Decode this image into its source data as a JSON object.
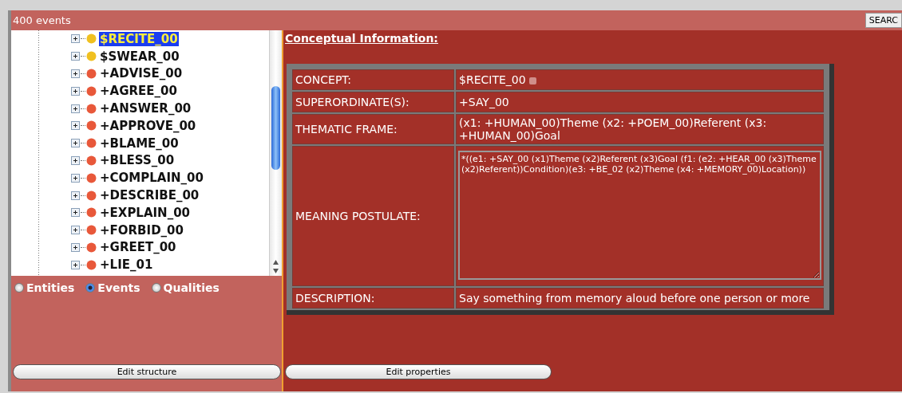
{
  "header": {
    "count": "400 events",
    "search_button": "SEARC"
  },
  "tree": [
    {
      "label": "$RECITE_00",
      "color": "#f0c020",
      "selected": true
    },
    {
      "label": "$SWEAR_00",
      "color": "#f0c020",
      "selected": false
    },
    {
      "label": "+ADVISE_00",
      "color": "#e8583a",
      "selected": false
    },
    {
      "label": "+AGREE_00",
      "color": "#e8583a",
      "selected": false
    },
    {
      "label": "+ANSWER_00",
      "color": "#e8583a",
      "selected": false
    },
    {
      "label": "+APPROVE_00",
      "color": "#e8583a",
      "selected": false
    },
    {
      "label": "+BLAME_00",
      "color": "#e8583a",
      "selected": false
    },
    {
      "label": "+BLESS_00",
      "color": "#e8583a",
      "selected": false
    },
    {
      "label": "+COMPLAIN_00",
      "color": "#e8583a",
      "selected": false
    },
    {
      "label": "+DESCRIBE_00",
      "color": "#e8583a",
      "selected": false
    },
    {
      "label": "+EXPLAIN_00",
      "color": "#e8583a",
      "selected": false
    },
    {
      "label": "+FORBID_00",
      "color": "#e8583a",
      "selected": false
    },
    {
      "label": "+GREET_00",
      "color": "#e8583a",
      "selected": false
    },
    {
      "label": "+LIE_01",
      "color": "#e8583a",
      "selected": false
    }
  ],
  "categories": [
    {
      "label": "Entities",
      "selected": false
    },
    {
      "label": "Events",
      "selected": true
    },
    {
      "label": "Qualities",
      "selected": false
    }
  ],
  "left_button": "Edit structure",
  "section_title": "Conceptual Information:",
  "properties": [
    {
      "kind": "text",
      "label": "CONCEPT:",
      "value": "$RECITE_00",
      "marker": true
    },
    {
      "kind": "text",
      "label": "SUPERORDINATE(S):",
      "value": "+SAY_00"
    },
    {
      "kind": "text",
      "label": "THEMATIC FRAME:",
      "value": "(x1: +HUMAN_00)Theme (x2: +POEM_00)Referent (x3: +HUMAN_00)Goal"
    },
    {
      "kind": "textarea",
      "label": "MEANING POSTULATE:",
      "value": "*((e1: +SAY_00 (x1)Theme (x2)Referent (x3)Goal (f1: (e2: +HEAR_00 (x3)Theme (x2)Referent))Condition)(e3: +BE_02 (x2)Theme (x4: +MEMORY_00)Location))"
    },
    {
      "kind": "text",
      "label": "DESCRIPTION:",
      "value": "Say something from memory aloud before one person or more"
    }
  ],
  "right_button": "Edit properties"
}
